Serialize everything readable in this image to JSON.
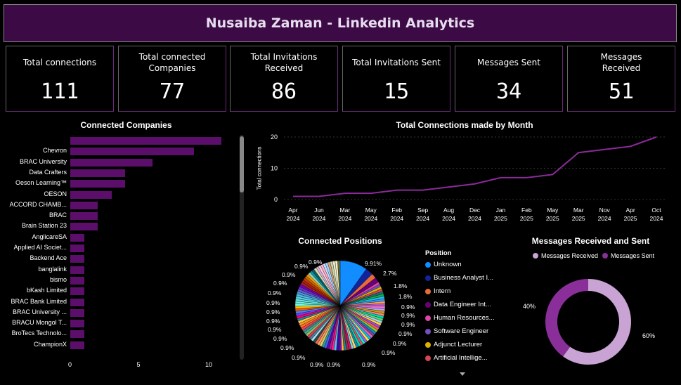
{
  "header": {
    "title": "Nusaiba Zaman - Linkedin Analytics"
  },
  "kpis": [
    {
      "label": "Total connections",
      "value": "111"
    },
    {
      "label": "Total connected Companies",
      "value": "77"
    },
    {
      "label": "Total Invitations Received",
      "value": "86"
    },
    {
      "label": "Total Invitations Sent",
      "value": "15"
    },
    {
      "label": "Messages Sent",
      "value": "34"
    },
    {
      "label": "Messages Received",
      "value": "51"
    }
  ],
  "companies_chart": {
    "title": "Connected Companies",
    "x_ticks": [
      "0",
      "5",
      "10"
    ]
  },
  "monthly_chart": {
    "title": "Total Connections made by Month",
    "ylabel": "Total connections",
    "y_ticks": [
      "0",
      "10",
      "20"
    ]
  },
  "positions_chart": {
    "title": "Connected Positions",
    "legend_title": "Position",
    "labels": {
      "unknown_pct": "9.91%",
      "pct_27": "2.7%",
      "pct_18a": "1.8%",
      "pct_18b": "1.8%",
      "small": "0.9%"
    }
  },
  "messages_chart": {
    "title": "Messages Received and Sent",
    "legend": [
      "Messages Received",
      "Messages Sent"
    ],
    "sent_label": "40%",
    "received_label": "60%"
  },
  "colors": {
    "accent": "#8b2a9a",
    "header_bg": "#3c0a45",
    "bar": "#5c0f6a",
    "donut_light": "#c9a3d4",
    "donut_dark": "#8a2f9a"
  },
  "chart_data": [
    {
      "type": "bar",
      "title": "Connected Companies",
      "categories": [
        "",
        "Chevron",
        "BRAC University",
        "Data Crafters",
        "Oeson Learning™",
        "OESON",
        "ACCORD CHAMB...",
        "BRAC",
        "Brain Station 23",
        "AnglicareSA",
        "Applied AI Societ...",
        "Backend Ace",
        "banglalink",
        "bismo",
        "bKash Limited",
        "BRAC Bank Limited",
        "BRAC University ...",
        "BRACU Mongol T...",
        "BroTecs Technolo...",
        "ChampionX"
      ],
      "values": [
        11,
        9,
        6,
        4,
        4,
        3,
        2,
        2,
        2,
        1,
        1,
        1,
        1,
        1,
        1,
        1,
        1,
        1,
        1,
        1
      ],
      "xlim": [
        0,
        11.5
      ]
    },
    {
      "type": "line",
      "title": "Total Connections made by Month",
      "ylabel": "Total connections",
      "x": [
        "Apr 2024",
        "Jun 2024",
        "Mar 2024",
        "May 2024",
        "Feb 2024",
        "Sep 2024",
        "Aug 2024",
        "Dec 2024",
        "Jan 2025",
        "Feb 2025",
        "May 2025",
        "Mar 2025",
        "Nov 2024",
        "Apr 2025",
        "Oct 2024"
      ],
      "values": [
        1,
        1,
        2,
        2,
        3,
        3,
        4,
        5,
        7,
        7,
        8,
        15,
        16,
        17,
        20
      ],
      "ylim": [
        0,
        21
      ]
    },
    {
      "type": "pie",
      "title": "Connected Positions",
      "categories": [
        "Unknown",
        "Business Analyst I...",
        "Intern",
        "Data Engineer Int...",
        "Human Resources...",
        "Software Engineer",
        "Adjunct Lecturer",
        "Artificial Intellige..."
      ],
      "values": [
        9.91,
        2.7,
        1.8,
        1.8,
        0.9,
        0.9,
        0.9,
        0.9
      ]
    },
    {
      "type": "pie",
      "title": "Messages Received and Sent",
      "categories": [
        "Messages Received",
        "Messages Sent"
      ],
      "values": [
        60,
        40
      ]
    }
  ]
}
